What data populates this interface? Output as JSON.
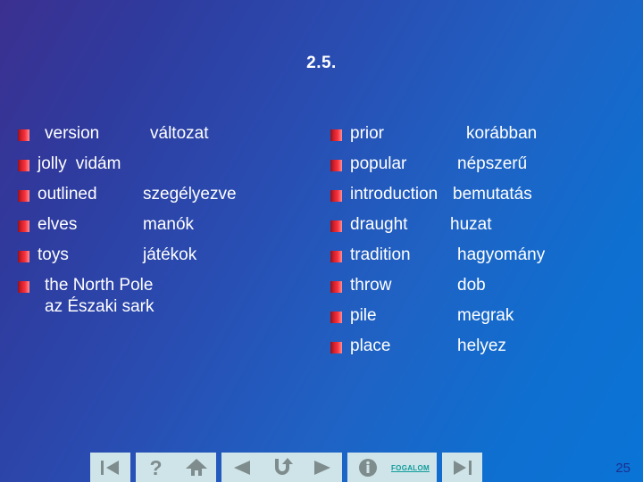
{
  "slide": {
    "title": "2.5.",
    "page_number": "25",
    "background_from": "#3b3090",
    "background_to": "#0a74d6",
    "bullet_color": "#f8323c",
    "text_color": "#ffffff"
  },
  "columns": {
    "left": [
      {
        "en": "version",
        "hu": "változat"
      },
      {
        "en": "jolly",
        "hu": "vidám"
      },
      {
        "en": "outlined",
        "hu": "szegélyezve"
      },
      {
        "en": "elves",
        "hu": "manók"
      },
      {
        "en": "toys",
        "hu": "játékok"
      },
      {
        "en": "the North Pole",
        "hu": "az Északi sark"
      }
    ],
    "right": [
      {
        "en": "prior",
        "hu": "korábban"
      },
      {
        "en": "popular",
        "hu": "népszerű"
      },
      {
        "en": "introduction",
        "hu": "bemutatás"
      },
      {
        "en": "draught",
        "hu": "huzat"
      },
      {
        "en": "tradition",
        "hu": "hagyomány"
      },
      {
        "en": "throw",
        "hu": "dob"
      },
      {
        "en": "pile",
        "hu": "megrak"
      },
      {
        "en": "place",
        "hu": "helyez"
      }
    ]
  },
  "toolbar": {
    "first_slide": "first-slide-icon",
    "help": "?",
    "home": "home-icon",
    "previous": "previous-slide-icon",
    "return": "return-arrow-icon",
    "next": "next-slide-icon",
    "info": "info-icon",
    "fogalom_label": "FOGALOM",
    "last_slide": "last-slide-icon",
    "button_face_color": "#cfe4e8",
    "glyph_color": "#7f8c8d",
    "link_color": "#0f9c9c"
  }
}
